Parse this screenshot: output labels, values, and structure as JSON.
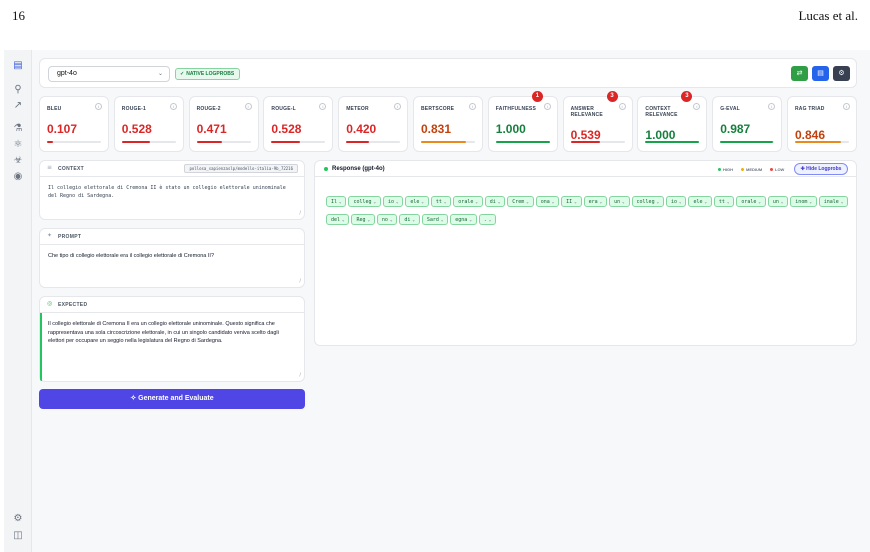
{
  "paper": {
    "page_number": "16",
    "authors": "Lucas et al."
  },
  "colors": {
    "accent": "#4f46e5",
    "high": "#22c55e",
    "medium": "#eab308",
    "low": "#ef4444",
    "badge": "#dc2626"
  },
  "sidebar": {
    "icons": [
      "chart-icon",
      "trophy-icon",
      "trend-icon",
      "flask-icon",
      "atom-icon",
      "bug-icon",
      "shield-icon"
    ],
    "bottom_icons": [
      "settings-icon",
      "panel-icon"
    ]
  },
  "toolbar": {
    "model_value": "gpt-4o",
    "native_badge": "NATIVE LOGPROBS",
    "buttons": [
      "shuffle-button",
      "database-button",
      "settings-button"
    ]
  },
  "metrics": [
    {
      "label": "BLEU",
      "value": "0.107",
      "progress": 0.107,
      "color": "#dc2626"
    },
    {
      "label": "ROUGE-1",
      "value": "0.528",
      "progress": 0.528,
      "color": "#dc2626"
    },
    {
      "label": "ROUGE-2",
      "value": "0.471",
      "progress": 0.471,
      "color": "#dc2626"
    },
    {
      "label": "ROUGE-L",
      "value": "0.528",
      "progress": 0.528,
      "color": "#dc2626"
    },
    {
      "label": "METEOR",
      "value": "0.420",
      "progress": 0.42,
      "color": "#dc2626"
    },
    {
      "label": "BERTSCORE",
      "value": "0.831",
      "progress": 0.831,
      "color": "#ea8a1c"
    },
    {
      "label": "FAITHFULNESS",
      "value": "1.000",
      "progress": 1.0,
      "color": "#16a34a",
      "badge": "1"
    },
    {
      "label": "ANSWER RELEVANCE",
      "value": "0.539",
      "progress": 0.539,
      "color": "#dc2626",
      "badge": "3"
    },
    {
      "label": "CONTEXT RELEVANCE",
      "value": "1.000",
      "progress": 1.0,
      "color": "#16a34a",
      "badge": "3"
    },
    {
      "label": "G-EVAL",
      "value": "0.987",
      "progress": 0.987,
      "color": "#16a34a"
    },
    {
      "label": "RAG TRIAD",
      "value": "0.846",
      "progress": 0.846,
      "color": "#ea8a1c"
    }
  ],
  "context": {
    "title": "CONTEXT",
    "tag": "pollosa_sapienzaslp/modello-italia-9b_72216",
    "text": "Il collegio elettorale di Cremona II è stato un collegio elettorale uninominale del Regno di Sardegna."
  },
  "prompt": {
    "title": "PROMPT",
    "text": "Che tipo di collegio elettorale era il collegio elettorale di Cremona II?"
  },
  "expected": {
    "title": "EXPECTED",
    "text": "Il collegio elettorale di Cremona II era un collegio elettorale uninominale. Questo significa che rappresentava una sola circoscrizione elettorale, in cui un singolo candidato veniva scelto dagli elettori per occupare un seggio nella legislatura del Regno di Sardegna."
  },
  "generate_button": "Generate and Evaluate",
  "response": {
    "title": "Response (gpt-4o)",
    "legend": {
      "high": "HIGH",
      "medium": "MEDIUM",
      "low": "LOW"
    },
    "hide_button": "Hide Logprobs",
    "tokens": [
      "Il",
      "colleg",
      "io",
      "ele",
      "tt",
      "orale",
      "di",
      "Crem",
      "ona",
      "II",
      "era",
      "un",
      "colleg",
      "io",
      "ele",
      "tt",
      "orale",
      "un",
      "inom",
      "inale",
      "del",
      "Reg",
      "no",
      "di",
      "Sard",
      "egna",
      "."
    ]
  }
}
